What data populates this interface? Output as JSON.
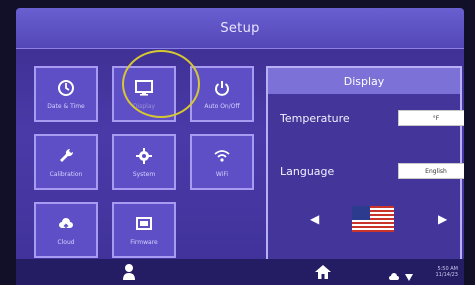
{
  "header": {
    "title": "Setup"
  },
  "tiles": [
    {
      "label": "Date & Time",
      "icon": "clock-icon"
    },
    {
      "label": "Display",
      "icon": "monitor-icon",
      "selected": true
    },
    {
      "label": "Auto On/Off",
      "icon": "power-icon"
    },
    {
      "label": "Calibration",
      "icon": "wrench-icon"
    },
    {
      "label": "System",
      "icon": "gear-icon"
    },
    {
      "label": "WiFi",
      "icon": "wifi-icon"
    },
    {
      "label": "Cloud",
      "icon": "cloud-icon"
    },
    {
      "label": "Firmware",
      "icon": "firmware-icon"
    }
  ],
  "panel": {
    "title": "Display",
    "temperature_label": "Temperature",
    "temperature_value": "°F",
    "language_label": "Language",
    "language_value": "English",
    "prev_arrow": "◀",
    "next_arrow": "▶",
    "flag": "us-flag"
  },
  "footer": {
    "user_icon": "user-icon",
    "home_icon": "home-icon",
    "cloud_icon": "cloud-icon",
    "wifi_icon": "wifi-icon",
    "time": "5:50 AM",
    "date": "11/14/23"
  },
  "colors": {
    "accent": "#5e4fc6",
    "highlight": "#d6c830",
    "panel_header": "#7b71d6"
  }
}
